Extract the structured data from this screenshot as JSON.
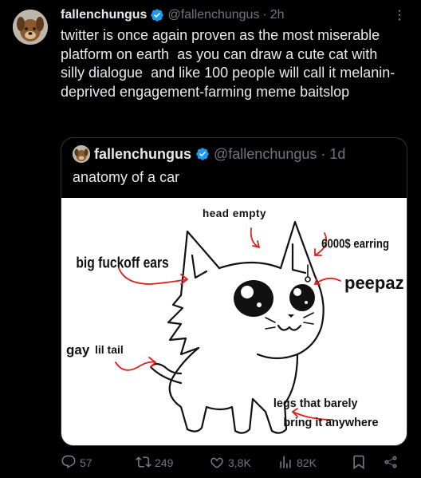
{
  "tweet": {
    "author_name": "fallenchungus",
    "author_handle": "@fallenchungus",
    "separator": "·",
    "time": "2h",
    "text": "twitter is once again proven as the most miserable platform on earth  as you can draw a cute cat with silly dialogue  and like 100 people will call it melanin-deprived engagement-farming meme baitslop"
  },
  "quoted_tweet": {
    "author_name": "fallenchungus",
    "author_handle": "@fallenchungus",
    "separator": "·",
    "time": "1d",
    "text": "anatomy of a car",
    "image_labels": {
      "head_empty": "head empty",
      "ears": "big fuckoff ears",
      "earring": "6000$ earring",
      "peepaz": "peepaz",
      "tail_gay": "gay",
      "tail_rest": "lil tail",
      "legs_line1": "legs that barely",
      "legs_line2": "bring it anywhere"
    }
  },
  "actions": {
    "replies": "57",
    "reposts": "249",
    "likes": "3,8K",
    "views": "82K"
  },
  "colors": {
    "background": "#000000",
    "text": "#e7e9ea",
    "muted": "#71767b",
    "verified": "#1d9bf0",
    "border": "#2f3336",
    "annotation_arrow": "#e0201b"
  }
}
